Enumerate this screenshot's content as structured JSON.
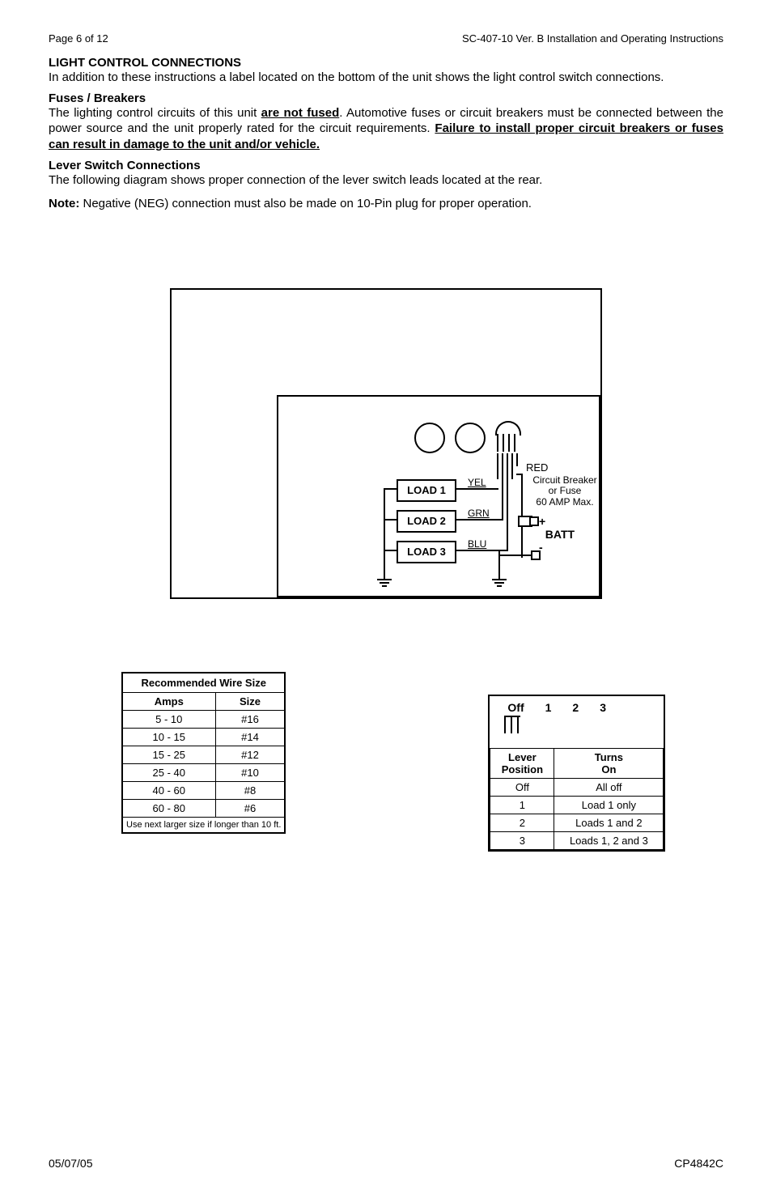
{
  "header": {
    "left": "Page 6 of 12",
    "right": "SC-407-10  Ver. B Installation and Operating Instructions"
  },
  "sections": {
    "title1": "LIGHT CONTROL CONNECTIONS",
    "para1": "In addition to these instructions a label located on the bottom of the unit shows the light control switch connections.",
    "fuses_h": "Fuses / Breakers",
    "fuses_p_a": "The lighting control circuits of this unit ",
    "fuses_p_b": "are not fused",
    "fuses_p_c": ".  Automotive fuses or circuit breakers must be connected between the power source and the unit properly rated for the circuit requirements.  ",
    "fuses_p_d": "Failure to install proper circuit breakers or fuses can result in damage to the unit and/or vehicle.",
    "lever_h": "Lever Switch Connections",
    "lever_p": "The following diagram shows proper connection of the lever switch leads located at the rear.",
    "note_label": "Note:",
    "note_body": "  Negative (NEG) connection must also be made on 10-Pin plug for proper operation."
  },
  "diagram": {
    "load1": "LOAD 1",
    "load2": "LOAD 2",
    "load3": "LOAD 3",
    "yel": "YEL",
    "grn": "GRN",
    "blu": "BLU",
    "red": "RED",
    "cb1": "Circuit Breaker",
    "cb2": "or Fuse",
    "cb3": "60 AMP Max.",
    "plus": "+",
    "batt": "BATT",
    "minus": "-"
  },
  "wire_table": {
    "title": "Recommended Wire Size",
    "h1": "Amps",
    "h2": "Size",
    "rows": [
      {
        "a": "5 - 10",
        "s": "#16"
      },
      {
        "a": "10 - 15",
        "s": "#14"
      },
      {
        "a": "15 - 25",
        "s": "#12"
      },
      {
        "a": "25 - 40",
        "s": "#10"
      },
      {
        "a": "40 - 60",
        "s": "#8"
      },
      {
        "a": "60 - 80",
        "s": "#6"
      }
    ],
    "foot": "Use next larger size if longer than 10 ft."
  },
  "lever_table": {
    "scale": {
      "off": "Off",
      "1": "1",
      "2": "2",
      "3": "3"
    },
    "h1a": "Lever",
    "h1b": "Position",
    "h2a": "Turns",
    "h2b": "On",
    "rows": [
      {
        "p": "Off",
        "t": "All off"
      },
      {
        "p": "1",
        "t": "Load 1 only"
      },
      {
        "p": "2",
        "t": "Loads 1 and 2"
      },
      {
        "p": "3",
        "t": "Loads 1, 2 and 3"
      }
    ]
  },
  "footer": {
    "left": "05/07/05",
    "right": "CP4842C"
  }
}
